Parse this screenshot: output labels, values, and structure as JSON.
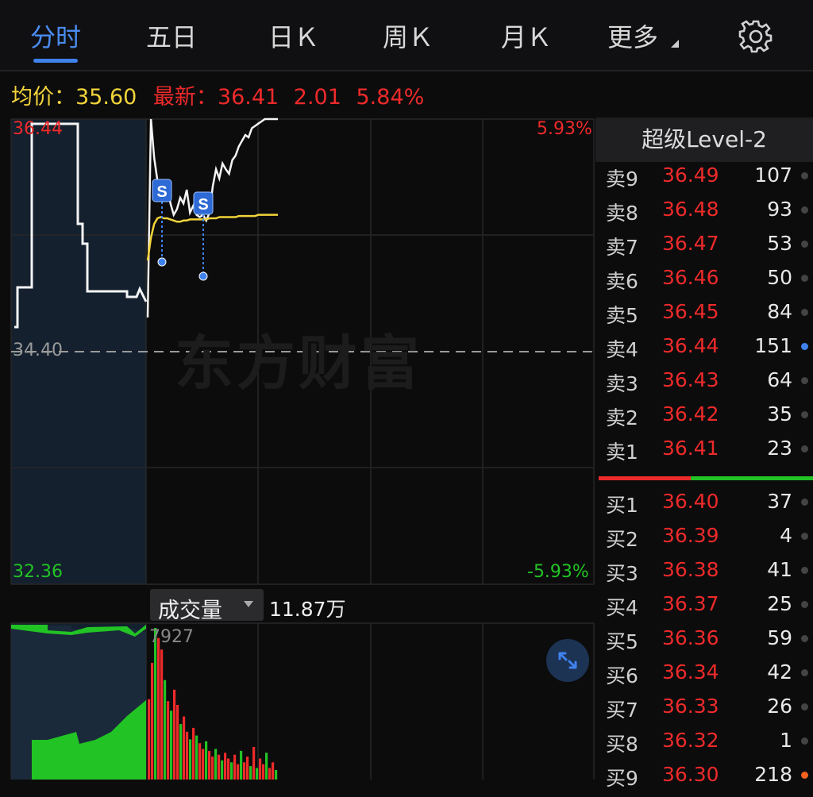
{
  "tabs": [
    {
      "label": "分时",
      "active": true
    },
    {
      "label": "五日",
      "active": false
    },
    {
      "label": "日Ｋ",
      "active": false
    },
    {
      "label": "周Ｋ",
      "active": false
    },
    {
      "label": "月Ｋ",
      "active": false
    },
    {
      "label": "更多",
      "active": false
    }
  ],
  "info": {
    "avg_label": "均价：",
    "avg_value": "35.60",
    "latest_label": "最新：",
    "latest_value": "36.41",
    "change": "2.01",
    "change_pct": "5.84%"
  },
  "chart_labels": {
    "high_price": "36.44",
    "high_pct": "5.93%",
    "prev_close": "34.40",
    "low_price": "32.36",
    "low_pct": "-5.93%",
    "max_volume": "7927"
  },
  "watermark": "东方财富",
  "trade_markers": [
    "S",
    "S"
  ],
  "volume": {
    "selector_label": "成交量",
    "total": "11.87万"
  },
  "order_book": {
    "title": "超级Level-2",
    "asks": [
      {
        "label": "卖9",
        "price": "36.49",
        "qty": "107"
      },
      {
        "label": "卖8",
        "price": "36.48",
        "qty": "93"
      },
      {
        "label": "卖7",
        "price": "36.47",
        "qty": "53"
      },
      {
        "label": "卖6",
        "price": "36.46",
        "qty": "50"
      },
      {
        "label": "卖5",
        "price": "36.45",
        "qty": "84"
      },
      {
        "label": "卖4",
        "price": "36.44",
        "qty": "151",
        "marker": "blue"
      },
      {
        "label": "卖3",
        "price": "36.43",
        "qty": "64"
      },
      {
        "label": "卖2",
        "price": "36.42",
        "qty": "35"
      },
      {
        "label": "卖1",
        "price": "36.41",
        "qty": "23"
      }
    ],
    "bids": [
      {
        "label": "买1",
        "price": "36.40",
        "qty": "37"
      },
      {
        "label": "买2",
        "price": "36.39",
        "qty": "4"
      },
      {
        "label": "买3",
        "price": "36.38",
        "qty": "41"
      },
      {
        "label": "买4",
        "price": "36.37",
        "qty": "25"
      },
      {
        "label": "买5",
        "price": "36.36",
        "qty": "59"
      },
      {
        "label": "买6",
        "price": "36.34",
        "qty": "42"
      },
      {
        "label": "买7",
        "price": "36.33",
        "qty": "26"
      },
      {
        "label": "买8",
        "price": "36.32",
        "qty": "1"
      },
      {
        "label": "买9",
        "price": "36.30",
        "qty": "218",
        "marker": "orange"
      }
    ],
    "buy_sell_ratio": 0.43
  },
  "colors": {
    "up": "#ee2a2a",
    "down": "#22c324",
    "price_line": "#f4f4f4",
    "avg_line": "#f2d43a",
    "accent": "#3f82ee"
  },
  "chart_data": {
    "type": "line",
    "x": [
      0,
      2,
      4,
      6,
      8,
      10,
      12,
      14,
      16,
      18,
      20,
      22,
      24,
      26,
      28,
      30,
      32,
      34,
      36,
      38,
      40,
      42,
      44,
      46,
      48,
      50,
      52,
      54,
      56,
      58,
      60,
      62,
      64,
      66,
      68,
      70,
      72,
      74,
      76,
      78,
      80
    ],
    "series": [
      {
        "values": [
          34.7,
          36.44,
          36.1,
          35.9,
          35.8,
          35.75,
          35.9,
          35.7,
          35.6,
          35.65,
          35.75,
          35.7,
          35.82,
          35.62,
          35.68,
          35.6,
          35.58,
          35.6,
          35.55,
          35.62,
          35.85,
          36.0,
          35.92,
          36.05,
          36.0,
          35.96,
          36.08,
          36.12,
          36.2,
          36.25,
          36.3,
          36.28,
          36.36,
          36.38,
          36.4,
          36.42,
          36.44,
          36.46,
          36.47,
          36.49,
          36.51
        ]
      },
      {
        "values": [
          35.2,
          35.4,
          35.52,
          35.57,
          35.58,
          35.57,
          35.57,
          35.56,
          35.55,
          35.54,
          35.54,
          35.55,
          35.55,
          35.56,
          35.56,
          35.56,
          35.56,
          35.56,
          35.56,
          35.57,
          35.57,
          35.57,
          35.58,
          35.58,
          35.58,
          35.58,
          35.58,
          35.58,
          35.59,
          35.59,
          35.59,
          35.59,
          35.59,
          35.59,
          35.6,
          35.6,
          35.6,
          35.6,
          35.6,
          35.6,
          35.6
        ]
      }
    ],
    "ylim": [
      32.36,
      36.44
    ],
    "volume": [
      4200,
      6100,
      7927,
      7400,
      6800,
      5200,
      4100,
      3600,
      4700,
      3900,
      2900,
      3300,
      2500,
      2100,
      2700,
      2300,
      1900,
      1600,
      2000,
      1500,
      1200,
      1600,
      1300,
      1000,
      1400,
      1100,
      900,
      1300,
      800,
      1500,
      900,
      1200,
      700,
      1700,
      600,
      1100,
      800,
      1400,
      600,
      900,
      500
    ],
    "volume_up": [
      true,
      true,
      false,
      true,
      true,
      false,
      true,
      false,
      true,
      true,
      false,
      true,
      true,
      false,
      true,
      false,
      true,
      true,
      false,
      true,
      true,
      false,
      true,
      false,
      true,
      true,
      false,
      true,
      true,
      false,
      true,
      true,
      false,
      true,
      false,
      true,
      true,
      false,
      true,
      true,
      false
    ]
  }
}
